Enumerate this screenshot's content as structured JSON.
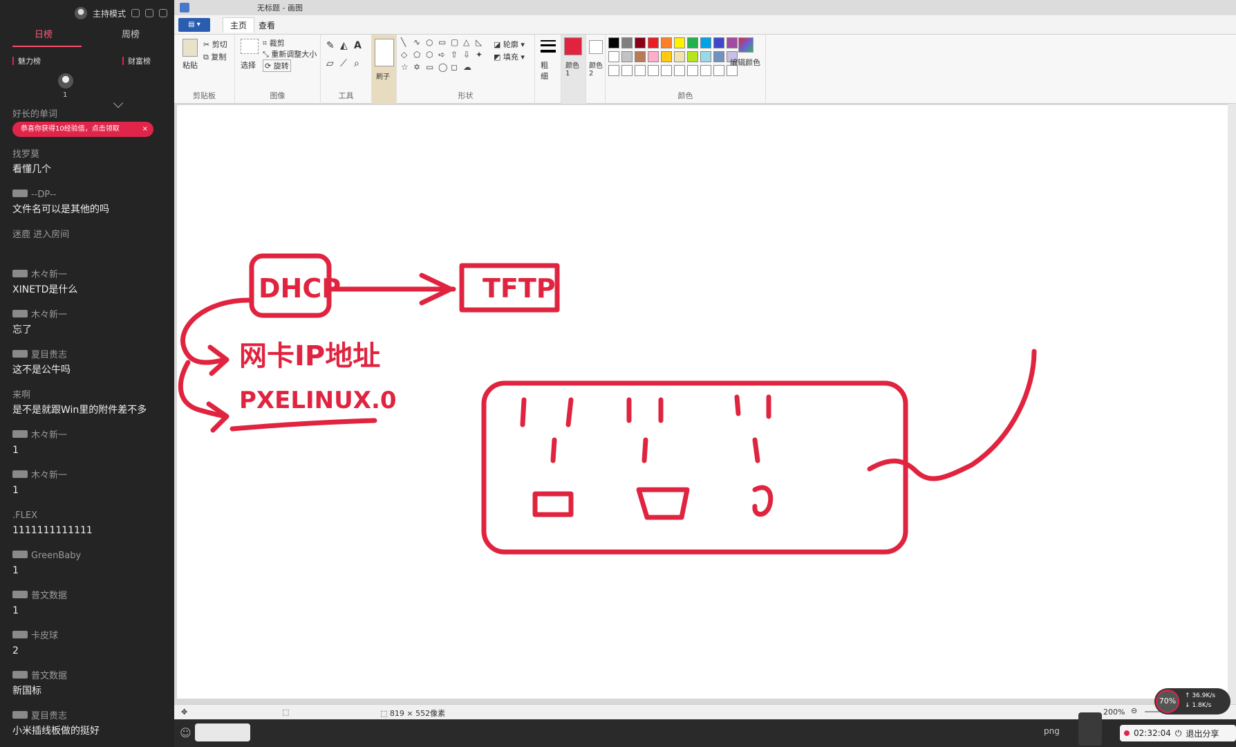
{
  "chat": {
    "host_mode_label": "主持模式",
    "tabs": [
      "日榜",
      "周榜"
    ],
    "subtabs": [
      "魅力榜",
      "财富榜"
    ],
    "rank_count": "1",
    "banner_text": "恭喜你获得10经验值，点击领取",
    "banner_close": "×",
    "messages": [
      {
        "name": "好长的单词",
        "text": "",
        "badge": false
      },
      {
        "name": "找罗莫",
        "text": "看懂几个",
        "badge": false
      },
      {
        "name": "--DP--",
        "text": "文件名可以是其他的吗",
        "badge": true
      },
      {
        "name": "迷鹿 进入房间",
        "text": "",
        "badge": false
      },
      {
        "name": "木々新一",
        "text": "XINETD是什么",
        "badge": true
      },
      {
        "name": "木々新一",
        "text": "忘了",
        "badge": true
      },
      {
        "name": "夏目贵志",
        "text": "这不是公牛吗",
        "badge": true
      },
      {
        "name": "来啊",
        "text": "是不是就跟Win里的附件差不多",
        "badge": false
      },
      {
        "name": "木々新一",
        "text": "1",
        "badge": true
      },
      {
        "name": "木々新一",
        "text": "1",
        "badge": true
      },
      {
        "name": ".FLEX",
        "text": "1111111111111",
        "badge": false
      },
      {
        "name": "GreenBaby",
        "text": "1",
        "badge": true
      },
      {
        "name": "普文数据",
        "text": "1",
        "badge": true
      },
      {
        "name": "卡皮球",
        "text": "2",
        "badge": true
      },
      {
        "name": "普文数据",
        "text": "新国标",
        "badge": true
      },
      {
        "name": "夏目贵志",
        "text": "小米插线板做的挺好",
        "badge": true
      }
    ]
  },
  "paint": {
    "window_title": "无标题 - 画图",
    "tabs": {
      "home": "主页",
      "view": "查看"
    },
    "clipboard": {
      "paste": "粘贴",
      "cut": "剪切",
      "copy": "复制",
      "label": "剪贴板"
    },
    "image": {
      "select": "选择",
      "crop": "裁剪",
      "resize": "重新调整大小",
      "rotate": "旋转",
      "label": "图像"
    },
    "tools_label": "工具",
    "shapes": {
      "outline": "轮廓",
      "fill": "填充",
      "label": "形状"
    },
    "size_label": "粗细",
    "color1_label": "颜色 1",
    "color2_label": "颜色 2",
    "edit_colors": "编辑颜色",
    "colors_label": "颜色",
    "brush_label": "刷子",
    "status": {
      "dimensions": "819 × 552像素",
      "zoom": "200%"
    },
    "colors": {
      "accent": "#e0243f",
      "palette_row1": [
        "#000000",
        "#7f7f7f",
        "#880015",
        "#ed1c24",
        "#ff7f27",
        "#fff200",
        "#22b14c",
        "#00a2e8",
        "#3f48cc",
        "#a349a4"
      ],
      "palette_row2": [
        "#ffffff",
        "#c3c3c3",
        "#b97a57",
        "#ffaec9",
        "#ffc90e",
        "#efe4b0",
        "#b5e61d",
        "#99d9ea",
        "#7092be",
        "#c8bfe7"
      ]
    }
  },
  "drawing": {
    "dhcp": "DHCP",
    "tftp": "TFTP",
    "nic_ip": "网卡IP地址",
    "pxelinux": "PXELINUX.0"
  },
  "overlay": {
    "net_percent": "70%",
    "upload": "36.9K/s",
    "download": "1.8K/s",
    "timer": "02:32:04",
    "exit_share": "退出分享",
    "png": "png"
  }
}
